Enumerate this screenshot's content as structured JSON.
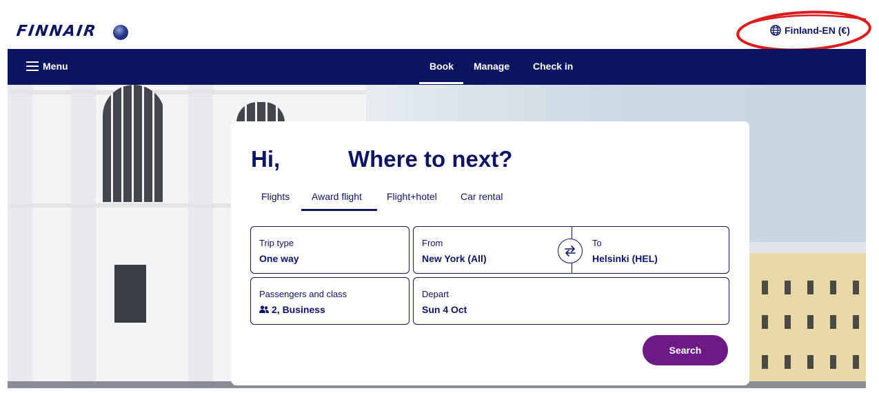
{
  "header": {
    "logo_text": "FINNAIR",
    "alliance_logo": "oneworld-globe",
    "locale_label": "Finland-EN (€)",
    "locale_icon": "globe-icon",
    "annotation_color": "#d81e1e"
  },
  "nav": {
    "menu_label": "Menu",
    "links": [
      "Book",
      "Manage",
      "Check in"
    ],
    "active": "Book"
  },
  "booking": {
    "greeting": "Hi,",
    "headline": "Where to next?",
    "tabs": [
      "Flights",
      "Award flight",
      "Flight+hotel",
      "Car rental"
    ],
    "active_tab": "Award flight",
    "trip_type": {
      "label": "Trip type",
      "value": "One way"
    },
    "from": {
      "label": "From",
      "value": "New York (All)"
    },
    "to": {
      "label": "To",
      "value": "Helsinki (HEL)"
    },
    "passengers": {
      "label": "Passengers and class",
      "value": "2, Business",
      "icon": "passengers-icon"
    },
    "depart": {
      "label": "Depart",
      "value": "Sun 4 Oct"
    },
    "search_label": "Search"
  },
  "colors": {
    "brand_navy": "#0b1560",
    "search_purple": "#6e1a86"
  }
}
